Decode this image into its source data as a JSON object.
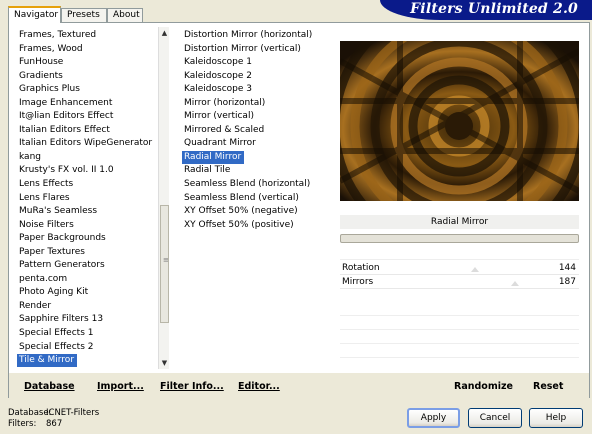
{
  "title": "Filters Unlimited 2.0",
  "tabs": [
    {
      "label": "Navigator"
    },
    {
      "label": "Presets"
    },
    {
      "label": "About"
    }
  ],
  "categories": {
    "items": [
      "Frames, Textured",
      "Frames, Wood",
      "FunHouse",
      "Gradients",
      "Graphics Plus",
      "Image Enhancement",
      "It@lian Editors Effect",
      "Italian Editors Effect",
      "Italian Editors WipeGenerator",
      "kang",
      "Krusty's FX vol. II 1.0",
      "Lens Effects",
      "Lens Flares",
      "MuRa's Seamless",
      "Noise Filters",
      "Paper Backgrounds",
      "Paper Textures",
      "Pattern Generators",
      "penta.com",
      "Photo Aging Kit",
      "Render",
      "Sapphire Filters 13",
      "Special Effects 1",
      "Special Effects 2",
      "Tile & Mirror"
    ],
    "selected": "Tile & Mirror"
  },
  "filters": {
    "items": [
      "Distortion Mirror (horizontal)",
      "Distortion Mirror (vertical)",
      "Kaleidoscope 1",
      "Kaleidoscope 2",
      "Kaleidoscope 3",
      "Mirror (horizontal)",
      "Mirror (vertical)",
      "Mirrored & Scaled",
      "Quadrant Mirror",
      "Radial Mirror",
      "Radial Tile",
      "Seamless Blend (horizontal)",
      "Seamless Blend (vertical)",
      "XY Offset 50% (negative)",
      "XY Offset 50% (positive)"
    ],
    "selected": "Radial Mirror"
  },
  "filter_name": "Radial Mirror",
  "params": [
    {
      "name": "Rotation",
      "value": "144",
      "fraction": 0.565
    },
    {
      "name": "Mirrors",
      "value": "187",
      "fraction": 0.733
    }
  ],
  "buttonbar": {
    "database": "Database",
    "import": "Import...",
    "filter_info": "Filter Info...",
    "editor": "Editor...",
    "randomize": "Randomize",
    "reset": "Reset"
  },
  "status": {
    "database_label": "Database:",
    "database_value": "ICNET-Filters",
    "filters_label": "Filters:",
    "filters_value": "867"
  },
  "buttons": {
    "apply": "Apply",
    "cancel": "Cancel",
    "help": "Help"
  },
  "colors": {
    "banner": "#0a1a8a",
    "selection": "#316ac5",
    "tab_highlight": "#e6a10a"
  }
}
